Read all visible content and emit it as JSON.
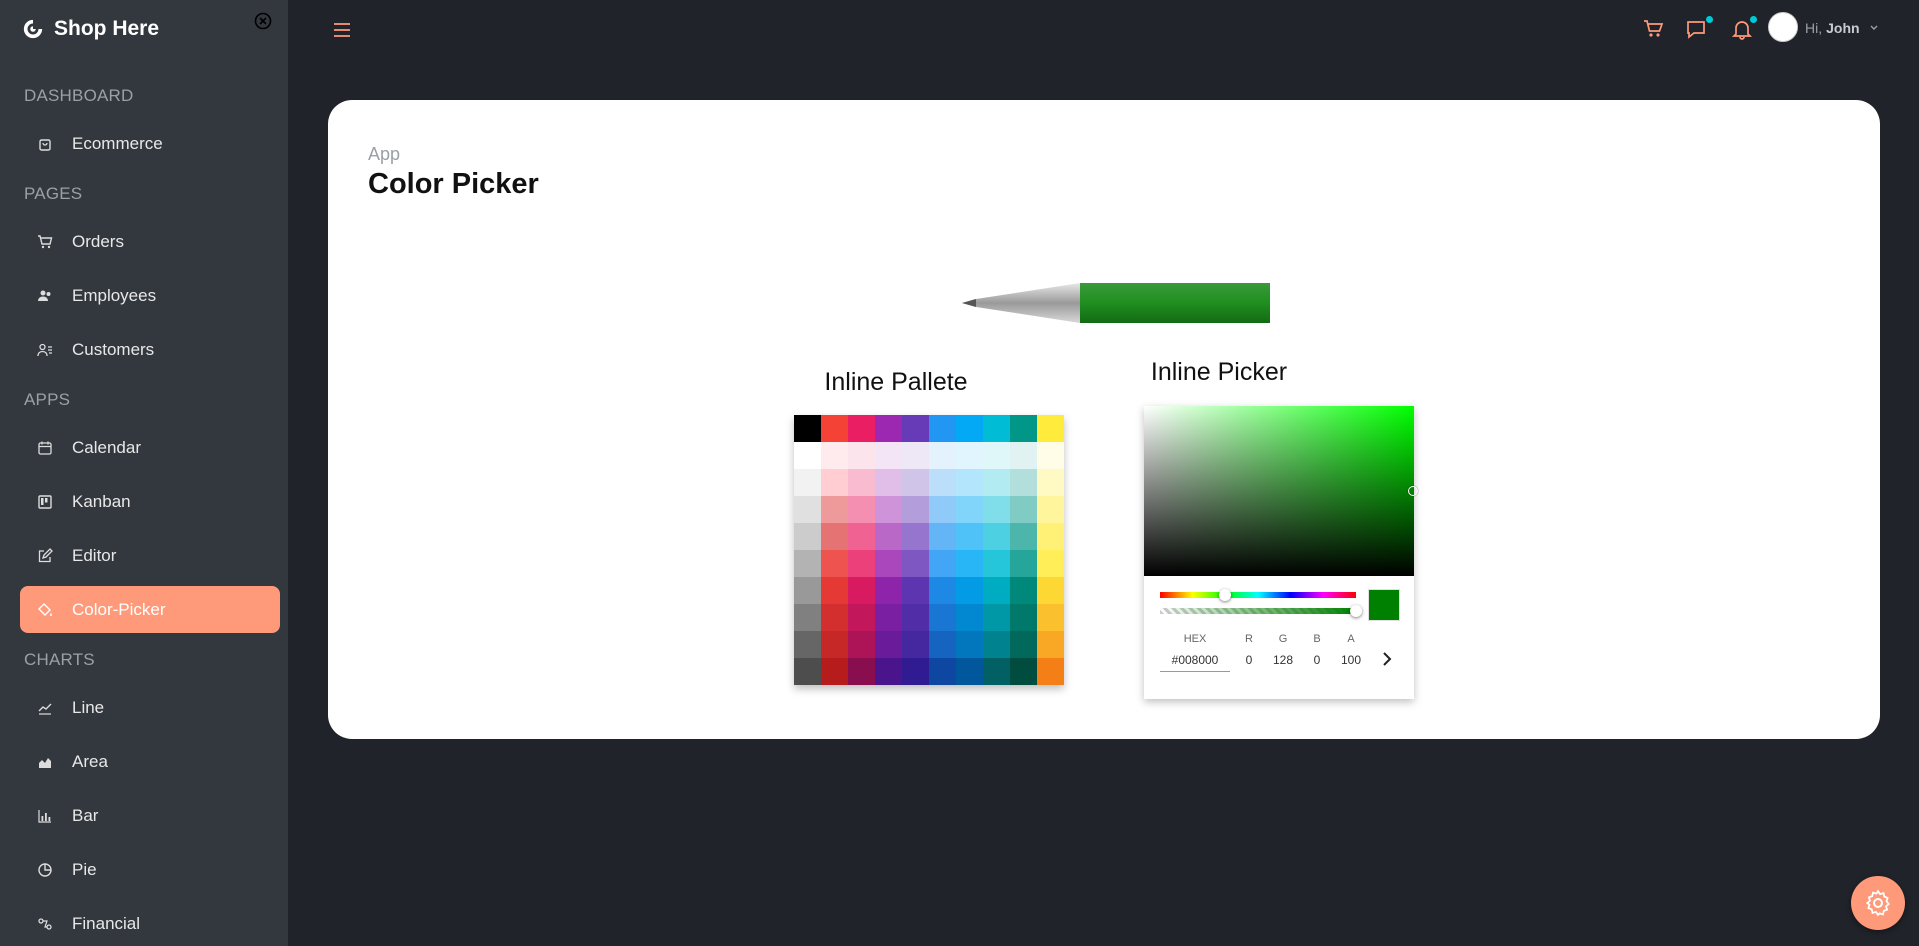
{
  "app": {
    "name": "Shop Here"
  },
  "sidebar": {
    "sections": [
      {
        "label": "DASHBOARD"
      },
      {
        "label": "PAGES"
      },
      {
        "label": "APPS"
      },
      {
        "label": "CHARTS"
      }
    ],
    "items": [
      {
        "label": "Ecommerce",
        "icon": "shopping-bag-icon"
      },
      {
        "label": "Orders",
        "icon": "cart-icon"
      },
      {
        "label": "Employees",
        "icon": "people-icon"
      },
      {
        "label": "Customers",
        "icon": "user-list-icon"
      },
      {
        "label": "Calendar",
        "icon": "calendar-icon"
      },
      {
        "label": "Kanban",
        "icon": "kanban-icon"
      },
      {
        "label": "Editor",
        "icon": "edit-icon"
      },
      {
        "label": "Color-Picker",
        "icon": "paint-bucket-icon",
        "active": true
      },
      {
        "label": "Line",
        "icon": "line-chart-icon"
      },
      {
        "label": "Area",
        "icon": "area-chart-icon"
      },
      {
        "label": "Bar",
        "icon": "bar-chart-icon"
      },
      {
        "label": "Pie",
        "icon": "pie-chart-icon"
      },
      {
        "label": "Financial",
        "icon": "financial-chart-icon"
      }
    ]
  },
  "header": {
    "greeting": "Hi,",
    "user_name": "John",
    "accent": "#fe9a7a",
    "badge_color": "#03c9d7"
  },
  "page": {
    "breadcrumb": "App",
    "title": "Color Picker"
  },
  "pen": {
    "color": "#008000"
  },
  "palette": {
    "heading": "Inline Pallete",
    "columns": [
      [
        "#000000",
        "#ffffff",
        "#f2f2f2",
        "#e0e0e0",
        "#cccccc",
        "#b3b3b3",
        "#999999",
        "#808080",
        "#666666",
        "#4d4d4d"
      ],
      [
        "#f44336",
        "#ffebee",
        "#ffcdd2",
        "#ef9a9a",
        "#e57373",
        "#ef5350",
        "#e53935",
        "#d32f2f",
        "#c62828",
        "#b71c1c"
      ],
      [
        "#e91e63",
        "#fce4ec",
        "#f8bbd0",
        "#f48fb1",
        "#f06292",
        "#ec407a",
        "#d81b60",
        "#c2185b",
        "#ad1457",
        "#880e4f"
      ],
      [
        "#9c27b0",
        "#f3e5f5",
        "#e1bee7",
        "#ce93d8",
        "#ba68c8",
        "#ab47bc",
        "#8e24aa",
        "#7b1fa2",
        "#6a1b9a",
        "#4a148c"
      ],
      [
        "#673ab7",
        "#ede7f6",
        "#d1c4e9",
        "#b39ddb",
        "#9575cd",
        "#7e57c2",
        "#5e35b1",
        "#512da8",
        "#4527a0",
        "#311b92"
      ],
      [
        "#2196f3",
        "#e3f2fd",
        "#bbdefb",
        "#90caf9",
        "#64b5f6",
        "#42a5f5",
        "#1e88e5",
        "#1976d2",
        "#1565c0",
        "#0d47a1"
      ],
      [
        "#03a9f4",
        "#e1f5fe",
        "#b3e5fc",
        "#81d4fa",
        "#4fc3f7",
        "#29b6f6",
        "#039be5",
        "#0288d1",
        "#0277bd",
        "#01579b"
      ],
      [
        "#00bcd4",
        "#e0f7fa",
        "#b2ebf2",
        "#80deea",
        "#4dd0e1",
        "#26c6da",
        "#00acc1",
        "#0097a7",
        "#00838f",
        "#006064"
      ],
      [
        "#009688",
        "#e0f2f1",
        "#b2dfdb",
        "#80cbc4",
        "#4db6ac",
        "#26a69a",
        "#00897b",
        "#00796b",
        "#00695c",
        "#004d40"
      ],
      [
        "#ffeb3b",
        "#fffde7",
        "#fff9c4",
        "#fff59d",
        "#fff176",
        "#ffee58",
        "#fdd835",
        "#fbc02d",
        "#f9a825",
        "#f57f17"
      ]
    ]
  },
  "picker": {
    "heading": "Inline Picker",
    "labels": {
      "hex": "HEX",
      "r": "R",
      "g": "G",
      "b": "B",
      "a": "A"
    },
    "values": {
      "hex": "#008000",
      "r": "0",
      "g": "128",
      "b": "0",
      "a": "100"
    },
    "hue_level": 0.33,
    "alpha_level": 1.0
  }
}
